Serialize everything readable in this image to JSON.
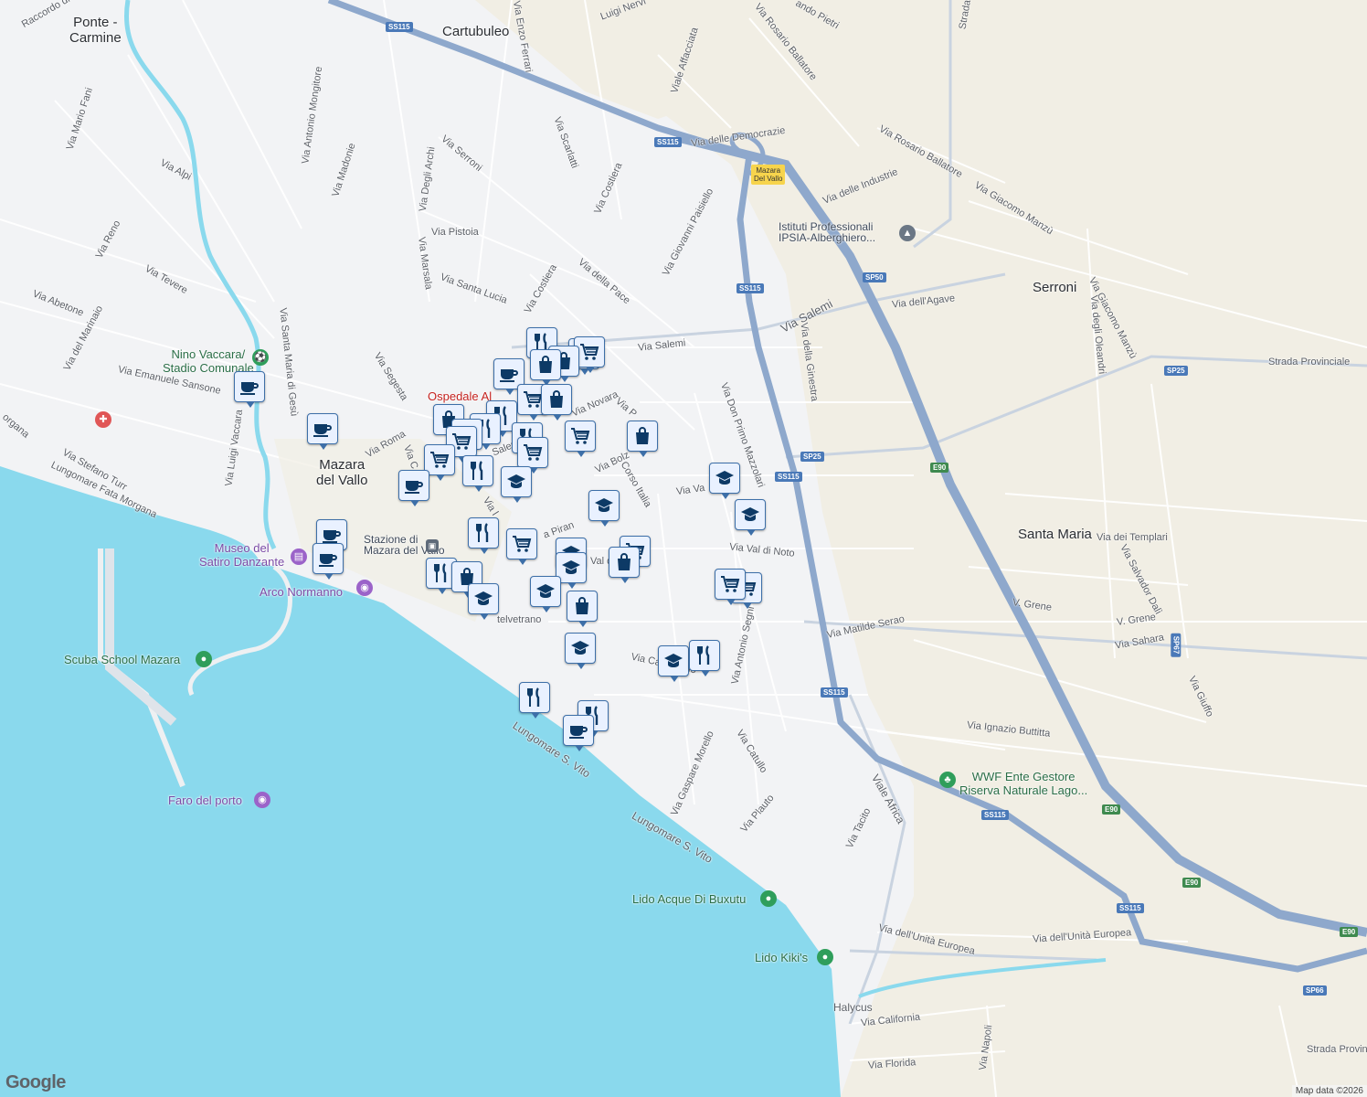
{
  "map": {
    "attribution": "Map data ©2026",
    "logo": "Google",
    "colors": {
      "sea": "#8ad9ed",
      "land": "#f2f3f5",
      "urban": "#f0ece0",
      "motorway": "#8ea8cc",
      "road": "#ffffff",
      "river": "#8ad9ed",
      "marker_bg": "#e9f1ff",
      "marker_border": "#3d6fa8",
      "marker_icon": "#0d3a66"
    }
  },
  "places": {
    "ponte_carmine": "Ponte -\nCarmine",
    "cartubuleo": "Cartubuleo",
    "mazara": "Mazara\ndel Vallo",
    "serroni": "Serroni",
    "santa_maria": "Santa Maria",
    "halycus": "Halycus"
  },
  "pois": {
    "stadio": "Nino Vaccara/\nStadio Comunale",
    "museo": "Museo del\nSatiro Danzante",
    "arco": "Arco Normanno",
    "scuba": "Scuba School Mazara",
    "faro": "Faro del porto",
    "ospedale": "Ospedale Al",
    "ipsia": "Istituti Professionali\nIPSIA-Alberghiero...",
    "stazione": "Stazione di\nMazara del Vallo",
    "wwf": "WWF Ente Gestore\nRiserva Naturale Lago...",
    "lido_buxutu": "Lido Acque Di Buxutu",
    "lido_kikis": "Lido Kiki's"
  },
  "streets": {
    "raccordo": "Raccordo di M",
    "luigi_nervi": "Luigi Nervi",
    "enzo_ferrari": "Via Enzo Ferrari",
    "affacciata": "Viale Affacciata",
    "rosario_ballatore": "Via Rosario Ballatore",
    "pietri": "ando Pietri",
    "strada_top": "Strada",
    "mario_fani": "Via Mario Fani",
    "mongitore": "Via Antonio Mongitore",
    "alpi": "Via Alpi",
    "madonie": "Via Madonie",
    "degli_archi": "Via Degli Archi",
    "serroni_st": "Via Serroni",
    "scarlatti": "Via Scarlatti",
    "costiera": "Via Costiera",
    "democrazie": "Via delle Democrazie",
    "rosario_ballatore2": "Via Rosario Ballatore",
    "industrie": "Via delle Industrie",
    "giacomo_manzu": "Via Giacomo Manzù",
    "reno": "Via Reno",
    "pistoia": "Via Pistoia",
    "paisiello": "Via Giovanni Paisiello",
    "tevere": "Via Tevere",
    "marsala": "Via Marsala",
    "santa_lucia": "Via Santa Lucia",
    "costiera2": "Via Costiera",
    "della_pace": "Via della Pace",
    "agave": "Via dell'Agave",
    "manzu2": "Via Giacomo Manzù",
    "oleandri": "Via degli Oleandri",
    "abetone": "Via Abetone",
    "santa_maria_gesu": "Via Santa Maria di Gesù",
    "salemi": "Via Salemi",
    "salemi2": "Via Salemi",
    "ginestra": "Via della Ginestra",
    "strada_provinciale": "Strada Provinciale",
    "marinaio": "Via del Marinaio",
    "sansone": "Via Emanuele Sansone",
    "segesta": "Via Segesta",
    "novara": "Via Novara",
    "mazzolari": "Via Don Primo Mazzolari",
    "luigi_vaccara": "Via Luigi Vaccara",
    "roma": "Via Roma",
    "morgana": "organa",
    "stefano_turr": "Via Stefano Turr",
    "fata_morgana": "Lungomare Fata Morgana",
    "corso_italia": "Corso Italia",
    "bolzano": "Via Bolz",
    "val": "Via Va",
    "val_di_noto": "Via Val di Noto",
    "templari": "Via dei Templari",
    "salvador_dali": "Via Salvador Dalì",
    "matilde_serao": "Via Matilde Serao",
    "v_grene": "V. Grene",
    "v_grene2": "V. Grene",
    "sahara": "Via Sahara",
    "castelvetrano": "telvetrano",
    "ca_vetrano": "Via Ca  vetrano",
    "antonio_segni": "Via Antonio Segni",
    "giuffo": "Via Giuffo",
    "ignazio_buttitta": "Via Ignazio Buttitta",
    "lungomare_s_vito": "Lungomare S. Vito",
    "lungomare_s_vito2": "Lungomare S. Vito",
    "gaspare_morello": "Via Gaspare Morello",
    "catullo": "Via Catullo",
    "plauto": "Via Plauto",
    "tacito": "Via Tacito",
    "viale_africa": "Viale Africa",
    "unita_europea": "Via dell'Unità Europea",
    "unita_europea2": "Via dell'Unità Europea",
    "california": "Via California",
    "napoli": "Via Napoli",
    "florida": "Via Florida",
    "strada_prov2": "Strada Provin",
    "via_p": "Via P",
    "via_pirano": "a Piran",
    "val_di": "Val di",
    "salem_short": "Salem",
    "via_c": "Via C",
    "via_l": "Via l"
  },
  "shields": {
    "ss115_a": "SS115",
    "ss115_b": "SS115",
    "ss115_c": "SS115",
    "ss115_d": "SS115",
    "ss115_e": "SS115",
    "ss115_f": "SS115",
    "ss115_g": "SS115",
    "sp50": "SP50",
    "sp25_a": "SP25",
    "sp25_b": "SP25",
    "sp67": "SP67",
    "sp66": "SP66",
    "e90_a": "E90",
    "e90_b": "E90",
    "e90_c": "E90",
    "e90_d": "E90",
    "exit": "Mazara\nDel Vallo"
  },
  "markers": {
    "cafe": "cafe-icon",
    "restaurant": "restaurant-icon",
    "shop": "shopping-bag-icon",
    "grocery": "grocery-cart-icon",
    "school": "school-icon"
  }
}
